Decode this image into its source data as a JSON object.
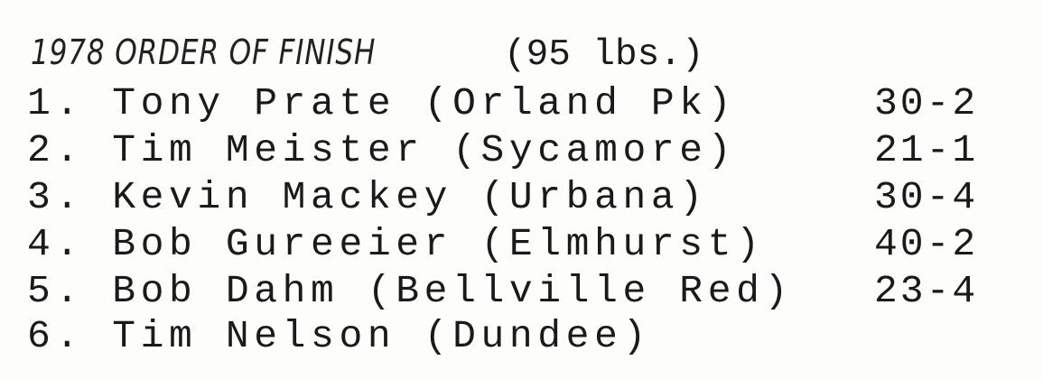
{
  "heading": {
    "handwritten": "1978 ORDER OF FINISH",
    "weight_class": "(95 lbs.)"
  },
  "results": [
    {
      "entry": "1. Tony Prate (Orland Pk)",
      "record": "30-2"
    },
    {
      "entry": "2. Tim Meister (Sycamore)",
      "record": "21-1"
    },
    {
      "entry": "3. Kevin Mackey (Urbana)",
      "record": "30-4"
    },
    {
      "entry": "4. Bob Gureeier (Elmhurst)",
      "record": "40-2"
    },
    {
      "entry": "5. Bob Dahm (Bellville Red)",
      "record": "23-4"
    },
    {
      "entry": "6. Tim Nelson (Dundee)",
      "record": ""
    }
  ]
}
